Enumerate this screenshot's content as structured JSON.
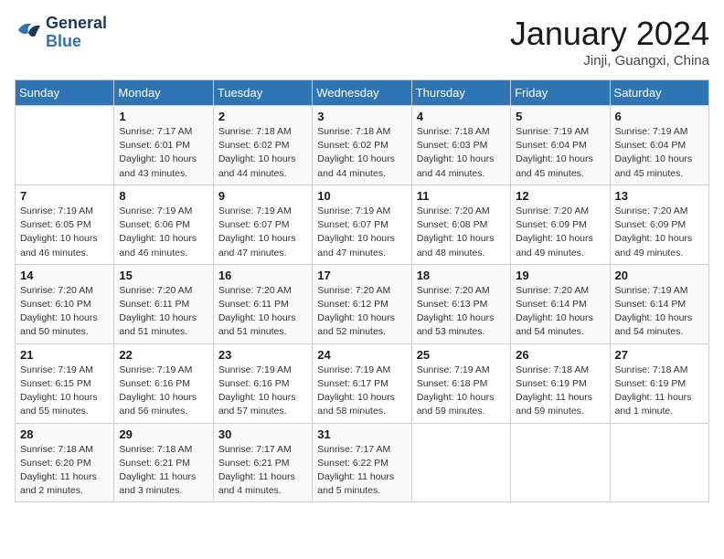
{
  "header": {
    "logo_line1": "General",
    "logo_line2": "Blue",
    "month_title": "January 2024",
    "location": "Jinji, Guangxi, China"
  },
  "weekdays": [
    "Sunday",
    "Monday",
    "Tuesday",
    "Wednesday",
    "Thursday",
    "Friday",
    "Saturday"
  ],
  "weeks": [
    [
      {
        "day": "",
        "info": ""
      },
      {
        "day": "1",
        "info": "Sunrise: 7:17 AM\nSunset: 6:01 PM\nDaylight: 10 hours\nand 43 minutes."
      },
      {
        "day": "2",
        "info": "Sunrise: 7:18 AM\nSunset: 6:02 PM\nDaylight: 10 hours\nand 44 minutes."
      },
      {
        "day": "3",
        "info": "Sunrise: 7:18 AM\nSunset: 6:02 PM\nDaylight: 10 hours\nand 44 minutes."
      },
      {
        "day": "4",
        "info": "Sunrise: 7:18 AM\nSunset: 6:03 PM\nDaylight: 10 hours\nand 44 minutes."
      },
      {
        "day": "5",
        "info": "Sunrise: 7:19 AM\nSunset: 6:04 PM\nDaylight: 10 hours\nand 45 minutes."
      },
      {
        "day": "6",
        "info": "Sunrise: 7:19 AM\nSunset: 6:04 PM\nDaylight: 10 hours\nand 45 minutes."
      }
    ],
    [
      {
        "day": "7",
        "info": "Sunrise: 7:19 AM\nSunset: 6:05 PM\nDaylight: 10 hours\nand 46 minutes."
      },
      {
        "day": "8",
        "info": "Sunrise: 7:19 AM\nSunset: 6:06 PM\nDaylight: 10 hours\nand 46 minutes."
      },
      {
        "day": "9",
        "info": "Sunrise: 7:19 AM\nSunset: 6:07 PM\nDaylight: 10 hours\nand 47 minutes."
      },
      {
        "day": "10",
        "info": "Sunrise: 7:19 AM\nSunset: 6:07 PM\nDaylight: 10 hours\nand 47 minutes."
      },
      {
        "day": "11",
        "info": "Sunrise: 7:20 AM\nSunset: 6:08 PM\nDaylight: 10 hours\nand 48 minutes."
      },
      {
        "day": "12",
        "info": "Sunrise: 7:20 AM\nSunset: 6:09 PM\nDaylight: 10 hours\nand 49 minutes."
      },
      {
        "day": "13",
        "info": "Sunrise: 7:20 AM\nSunset: 6:09 PM\nDaylight: 10 hours\nand 49 minutes."
      }
    ],
    [
      {
        "day": "14",
        "info": "Sunrise: 7:20 AM\nSunset: 6:10 PM\nDaylight: 10 hours\nand 50 minutes."
      },
      {
        "day": "15",
        "info": "Sunrise: 7:20 AM\nSunset: 6:11 PM\nDaylight: 10 hours\nand 51 minutes."
      },
      {
        "day": "16",
        "info": "Sunrise: 7:20 AM\nSunset: 6:11 PM\nDaylight: 10 hours\nand 51 minutes."
      },
      {
        "day": "17",
        "info": "Sunrise: 7:20 AM\nSunset: 6:12 PM\nDaylight: 10 hours\nand 52 minutes."
      },
      {
        "day": "18",
        "info": "Sunrise: 7:20 AM\nSunset: 6:13 PM\nDaylight: 10 hours\nand 53 minutes."
      },
      {
        "day": "19",
        "info": "Sunrise: 7:20 AM\nSunset: 6:14 PM\nDaylight: 10 hours\nand 54 minutes."
      },
      {
        "day": "20",
        "info": "Sunrise: 7:19 AM\nSunset: 6:14 PM\nDaylight: 10 hours\nand 54 minutes."
      }
    ],
    [
      {
        "day": "21",
        "info": "Sunrise: 7:19 AM\nSunset: 6:15 PM\nDaylight: 10 hours\nand 55 minutes."
      },
      {
        "day": "22",
        "info": "Sunrise: 7:19 AM\nSunset: 6:16 PM\nDaylight: 10 hours\nand 56 minutes."
      },
      {
        "day": "23",
        "info": "Sunrise: 7:19 AM\nSunset: 6:16 PM\nDaylight: 10 hours\nand 57 minutes."
      },
      {
        "day": "24",
        "info": "Sunrise: 7:19 AM\nSunset: 6:17 PM\nDaylight: 10 hours\nand 58 minutes."
      },
      {
        "day": "25",
        "info": "Sunrise: 7:19 AM\nSunset: 6:18 PM\nDaylight: 10 hours\nand 59 minutes."
      },
      {
        "day": "26",
        "info": "Sunrise: 7:18 AM\nSunset: 6:19 PM\nDaylight: 11 hours\nand 59 minutes."
      },
      {
        "day": "27",
        "info": "Sunrise: 7:18 AM\nSunset: 6:19 PM\nDaylight: 11 hours\nand 1 minute."
      }
    ],
    [
      {
        "day": "28",
        "info": "Sunrise: 7:18 AM\nSunset: 6:20 PM\nDaylight: 11 hours\nand 2 minutes."
      },
      {
        "day": "29",
        "info": "Sunrise: 7:18 AM\nSunset: 6:21 PM\nDaylight: 11 hours\nand 3 minutes."
      },
      {
        "day": "30",
        "info": "Sunrise: 7:17 AM\nSunset: 6:21 PM\nDaylight: 11 hours\nand 4 minutes."
      },
      {
        "day": "31",
        "info": "Sunrise: 7:17 AM\nSunset: 6:22 PM\nDaylight: 11 hours\nand 5 minutes."
      },
      {
        "day": "",
        "info": ""
      },
      {
        "day": "",
        "info": ""
      },
      {
        "day": "",
        "info": ""
      }
    ]
  ]
}
